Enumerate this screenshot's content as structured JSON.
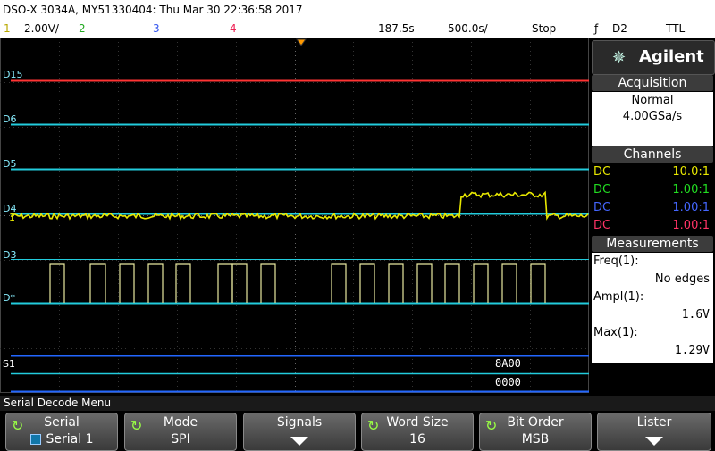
{
  "title": "DSO-X 3034A, MY51330404: Thu Mar 30 22:36:58 2017",
  "status": {
    "ch1_num": "1",
    "ch1_scale": "2.00V/",
    "ch2_num": "2",
    "ch3_num": "3",
    "ch4_num": "4",
    "time_delay": "187.5s",
    "time_scale": "500.0s/",
    "run_state": "Stop",
    "trigger_symbol": "ƒ",
    "trigger_source": "D2",
    "trigger_level": "TTL"
  },
  "screen": {
    "labels": [
      "D15",
      "D6",
      "D5",
      "D4",
      "D3",
      "D*",
      "S1"
    ],
    "ch1_marker": "1",
    "decode_values": [
      "8A00",
      "0000"
    ]
  },
  "logo": {
    "brand": "Agilent",
    "mark": "✵"
  },
  "acquisition": {
    "header": "Acquisition",
    "mode": "Normal",
    "rate": "4.00GSa/s"
  },
  "channels": {
    "header": "Channels",
    "rows": [
      {
        "coupling": "DC",
        "ratio": "10.0:1",
        "color": "#e8e800"
      },
      {
        "coupling": "DC",
        "ratio": "1.00:1",
        "color": "#22dd22"
      },
      {
        "coupling": "DC",
        "ratio": "1.00:1",
        "color": "#4466ff"
      },
      {
        "coupling": "DC",
        "ratio": "1.00:1",
        "color": "#ff3366"
      }
    ]
  },
  "measurements": {
    "header": "Measurements",
    "items": [
      {
        "name": "Freq(1):",
        "value": "No edges"
      },
      {
        "name": "Ampl(1):",
        "value": "1.6V"
      },
      {
        "name": "Max(1):",
        "value": "1.29V"
      }
    ]
  },
  "menu": {
    "title": "Serial Decode Menu",
    "keys": [
      {
        "label": "Serial",
        "value": "Serial 1"
      },
      {
        "label": "Mode",
        "value": "SPI"
      },
      {
        "label": "Signals",
        "value": ""
      },
      {
        "label": "Word Size",
        "value": "16"
      },
      {
        "label": "Bit Order",
        "value": "MSB"
      },
      {
        "label": "Lister",
        "value": ""
      }
    ]
  },
  "colors": {
    "ch1": "#e8e800",
    "digital": "#22ccdd",
    "serial_bus": "#2266ff",
    "ref_line": "#ff8800",
    "d15_line": "#ff3333"
  }
}
